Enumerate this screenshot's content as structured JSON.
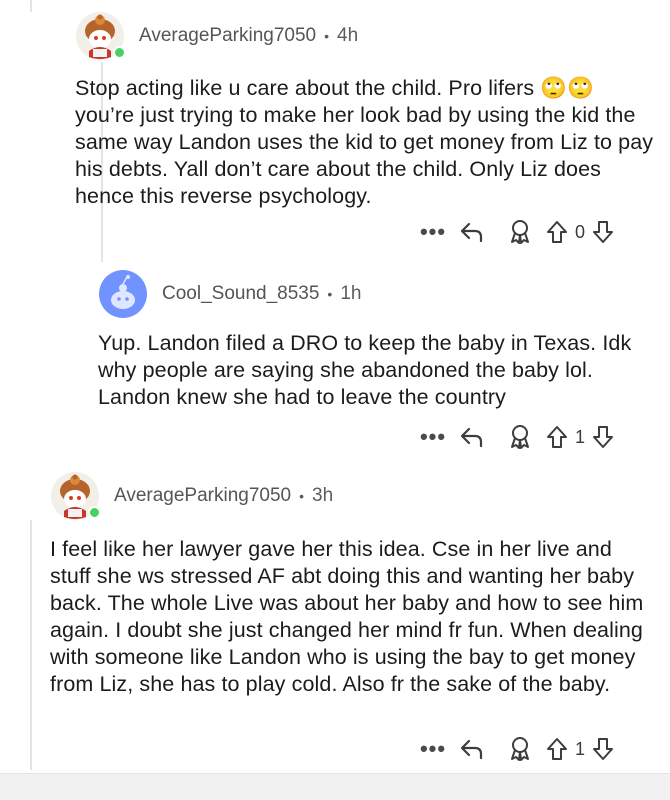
{
  "comments": [
    {
      "username": "AverageParking7050",
      "separator": "•",
      "time": "4h",
      "body": "Stop acting like u care about the child. Pro lifers 🙄🙄 you’re just trying to make her look bad by using the kid the same way Landon uses the kid to get money from Liz to pay his debts. Yall don’t care about the child. Only Liz does hence this reverse psychology.",
      "votes": "0",
      "online": true,
      "avatar_icon": "snoo-avatar-icon"
    },
    {
      "username": "Cool_Sound_8535",
      "separator": "•",
      "time": "1h",
      "body": "Yup. Landon filed a DRO to keep the baby in Texas. Idk why people are saying she abandoned the baby lol. Landon knew she had to leave the country",
      "votes": "1",
      "online": false,
      "avatar_icon": "default-snoo-avatar-icon"
    },
    {
      "username": "AverageParking7050",
      "separator": "•",
      "time": "3h",
      "body": "I feel like her lawyer gave her this idea. Cse in her live and stuff she ws stressed AF abt doing this and wanting her baby back. The whole Live was about her baby and how to see him again. I doubt she just changed her mind fr fun. When dealing with someone like Landon who is using the bay to get money from Liz, she has to play cold. Also fr the sake of the baby.",
      "votes": "1",
      "online": true,
      "avatar_icon": "snoo-avatar-icon"
    }
  ],
  "actions": {
    "more_label": "•••",
    "icons": [
      "more-options-icon",
      "reply-icon",
      "award-icon",
      "upvote-icon",
      "downvote-icon"
    ]
  },
  "colors": {
    "online": "#46d160",
    "default_avatar": "#7193ff",
    "thread_line": "#e4e4e4"
  }
}
